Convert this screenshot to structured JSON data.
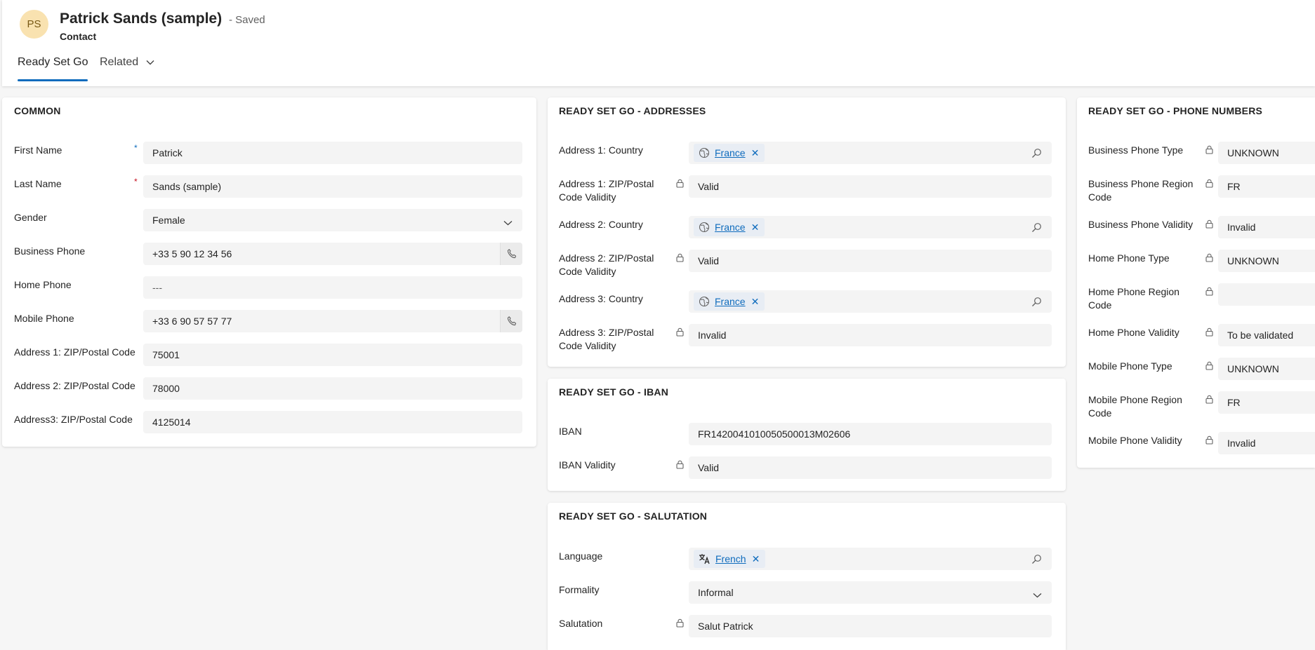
{
  "record": {
    "initials": "PS",
    "title": "Patrick Sands (sample)",
    "saved_status": "- Saved",
    "entity": "Contact"
  },
  "tabs": [
    {
      "label": "Ready Set Go",
      "active": true
    },
    {
      "label": "Related",
      "active": false
    }
  ],
  "common": {
    "title": "COMMON",
    "fields": [
      {
        "label": "First Name",
        "value": "Patrick",
        "required": "recommended"
      },
      {
        "label": "Last Name",
        "value": "Sands (sample)",
        "required": "required"
      },
      {
        "label": "Gender",
        "value": "Female",
        "type": "dropdown"
      },
      {
        "label": "Business Phone",
        "value": "+33 5 90 12 34 56",
        "type": "phone"
      },
      {
        "label": "Home Phone",
        "value": "---",
        "type": "empty"
      },
      {
        "label": "Mobile Phone",
        "value": "+33 6 90 57 57 77",
        "type": "phone"
      },
      {
        "label": "Address 1: ZIP/Postal Code",
        "value": "75001"
      },
      {
        "label": "Address 2: ZIP/Postal Code",
        "value": "78000"
      },
      {
        "label": "Address3: ZIP/Postal Code",
        "value": "4125014"
      }
    ]
  },
  "addresses": {
    "title": "READY SET GO - ADDRESSES",
    "fields": [
      {
        "label": "Address 1: Country",
        "value": "France",
        "type": "lookup"
      },
      {
        "label_line1": "Address 1: ZIP/Postal",
        "label_line2": "Code Validity",
        "value": "Valid",
        "locked": true
      },
      {
        "label": "Address 2: Country",
        "value": "France",
        "type": "lookup"
      },
      {
        "label_line1": "Address 2: ZIP/Postal",
        "label_line2": "Code Validity",
        "value": "Valid",
        "locked": true
      },
      {
        "label": "Address 3: Country",
        "value": "France",
        "type": "lookup"
      },
      {
        "label_line1": "Address 3: ZIP/Postal",
        "label_line2": "Code Validity",
        "value": "Invalid",
        "locked": true
      }
    ]
  },
  "iban": {
    "title": "READY SET GO - IBAN",
    "fields": [
      {
        "label": "IBAN",
        "value": "FR1420041010050500013M02606"
      },
      {
        "label": "IBAN Validity",
        "value": "Valid",
        "locked": true
      }
    ]
  },
  "salutation": {
    "title": "READY SET GO -  SALUTATION",
    "fields": [
      {
        "label": "Language",
        "value": "French",
        "type": "lookup"
      },
      {
        "label": "Formality",
        "value": "Informal",
        "type": "dropdown"
      },
      {
        "label": "Salutation",
        "value": "Salut Patrick",
        "locked": true
      }
    ]
  },
  "phones": {
    "title": "READY SET GO - PHONE NUMBERS",
    "fields": [
      {
        "label": "Business Phone Type",
        "value": "UNKNOWN",
        "locked": true
      },
      {
        "label_line1": "Business Phone Region",
        "label_line2": "Code",
        "value": "FR",
        "locked": true
      },
      {
        "label": "Business Phone Validity",
        "value": "Invalid",
        "locked": true
      },
      {
        "label": "Home Phone Type",
        "value": "UNKNOWN",
        "locked": true
      },
      {
        "label_line1": "Home Phone Region",
        "label_line2": "Code",
        "value": "",
        "locked": true
      },
      {
        "label": "Home Phone Validity",
        "value": "To be validated",
        "locked": true
      },
      {
        "label": "Mobile Phone Type",
        "value": "UNKNOWN",
        "locked": true
      },
      {
        "label_line1": "Mobile Phone Region",
        "label_line2": "Code",
        "value": "FR",
        "locked": true
      },
      {
        "label": "Mobile Phone Validity",
        "value": "Invalid",
        "locked": true
      }
    ]
  },
  "colors": {
    "accent": "#0f6cbd",
    "required": "#c50f1f",
    "avatar_bg": "#f9e2b0"
  }
}
